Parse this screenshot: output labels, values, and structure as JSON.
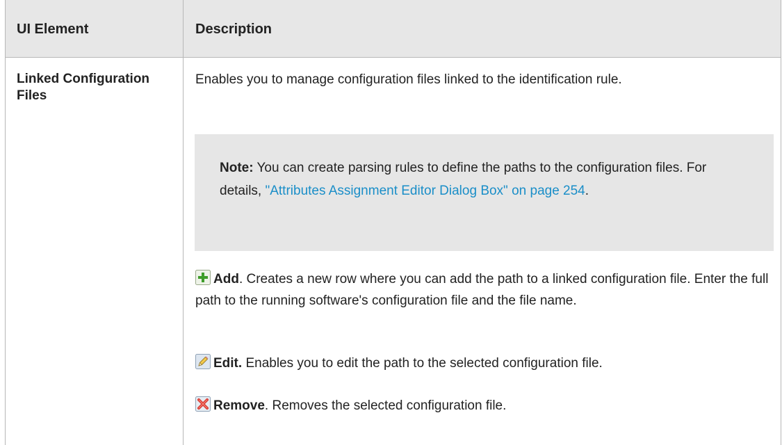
{
  "table": {
    "headers": {
      "ui_element": "UI Element",
      "description": "Description"
    },
    "row": {
      "name": "Linked Configuration Files",
      "intro": "Enables you to manage configuration files linked to the identification rule.",
      "note": {
        "label": "Note:",
        "text_before_link": " You can create parsing rules to define the paths to the configuration files. For details, ",
        "link_text": "\"Attributes Assignment Editor Dialog Box\" on page 254",
        "text_after_link": "."
      },
      "actions": [
        {
          "icon": "add-icon",
          "label": "Add",
          "label_punct": ".",
          "text": " Creates a new row where you can add the path to a linked configuration file. Enter the full path to the running software's configuration file and the file name."
        },
        {
          "icon": "edit-icon",
          "label": "Edit.",
          "label_punct": "",
          "text": " Enables you to edit the path to the selected configuration file."
        },
        {
          "icon": "remove-icon",
          "label": "Remove",
          "label_punct": ".",
          "text": " Removes the selected configuration file."
        }
      ]
    }
  },
  "colors": {
    "header_bg": "#e7e7e7",
    "note_bg": "#e6e6e6",
    "border": "#b7b7b7",
    "link": "#1a8ec8"
  }
}
